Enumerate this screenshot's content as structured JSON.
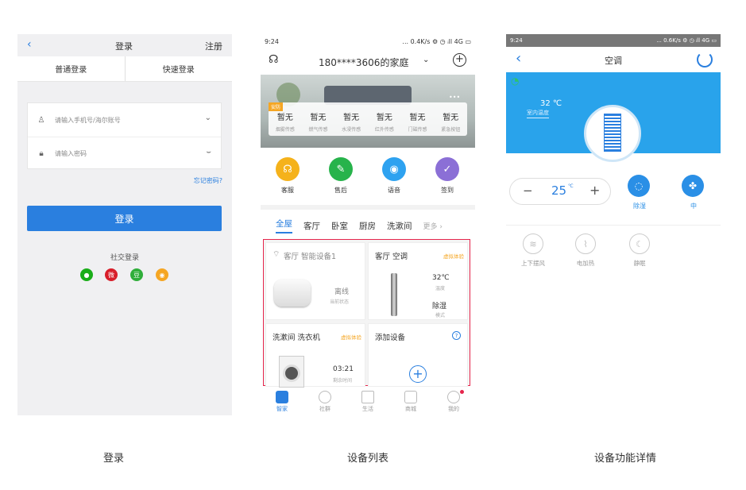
{
  "login": {
    "title": "登录",
    "register": "注册",
    "tabs": [
      "普通登录",
      "快速登录"
    ],
    "phone_placeholder": "请输入手机号/海尔账号",
    "password_placeholder": "请输入密码",
    "forgot": "忘记密码?",
    "login_button": "登录",
    "social_title": "社交登录",
    "social": [
      {
        "icon": "wechat-icon",
        "glyph": "●",
        "color": "#1aad19"
      },
      {
        "icon": "weibo-red-icon",
        "glyph": "微",
        "color": "#d81e2a"
      },
      {
        "icon": "douban-icon",
        "glyph": "豆",
        "color": "#2fae3a"
      },
      {
        "icon": "weibo-icon",
        "glyph": "◉",
        "color": "#f5a623"
      }
    ],
    "caption": "登录"
  },
  "devices": {
    "status_time": "9:24",
    "status_right": "... 0.4K/s ⚙ ◷ ᵢll 4G ▭",
    "home_title": "180****3606的家庭",
    "safety_tag": "安防",
    "sensors": [
      {
        "value": "暂无",
        "label": "烟雾传感"
      },
      {
        "value": "暂无",
        "label": "燃气传感"
      },
      {
        "value": "暂无",
        "label": "水浸传感"
      },
      {
        "value": "暂无",
        "label": "红外传感"
      },
      {
        "value": "暂无",
        "label": "门磁传感"
      },
      {
        "value": "暂无",
        "label": "紧急按钮"
      }
    ],
    "quick": [
      {
        "label": "客服",
        "color": "#f5b21b",
        "glyph": "☊"
      },
      {
        "label": "售后",
        "color": "#27b34b",
        "glyph": "✎"
      },
      {
        "label": "语音",
        "color": "#2ea2f0",
        "glyph": "◉"
      },
      {
        "label": "签到",
        "color": "#8b6fd6",
        "glyph": "✓"
      }
    ],
    "rooms": [
      "全屋",
      "客厅",
      "卧室",
      "厨房",
      "洗漱间",
      "更多 ›"
    ],
    "card1": {
      "title": "客厅 智能设备1",
      "state": "离线",
      "state_label": "当前状态"
    },
    "card2": {
      "title": "客厅 空调",
      "tag": "虚拟体验",
      "temp": "32℃",
      "temp_label": "温度",
      "mode": "除湿",
      "mode_label": "模式"
    },
    "card3": {
      "title": "洗漱间 洗衣机",
      "tag": "虚拟体验",
      "time": "03:21",
      "time_label": "剩余时间"
    },
    "card4": {
      "title": "添加设备"
    },
    "nav": [
      "智家",
      "社群",
      "生活",
      "商城",
      "我的"
    ],
    "caption": "设备列表"
  },
  "ac": {
    "status_time": "9:24",
    "status_right": "... 0.6K/s ⚙ ◷ ᵢll 4G ▭",
    "title": "空调",
    "indoor_temp": "32 ℃",
    "indoor_label": "室内温度",
    "set_temp": "25",
    "unit": "℃",
    "minus": "−",
    "plus": "+",
    "modes": [
      "除湿",
      "中"
    ],
    "funcs": [
      "上下摆风",
      "电加热",
      "静眠"
    ],
    "caption": "设备功能详情"
  }
}
